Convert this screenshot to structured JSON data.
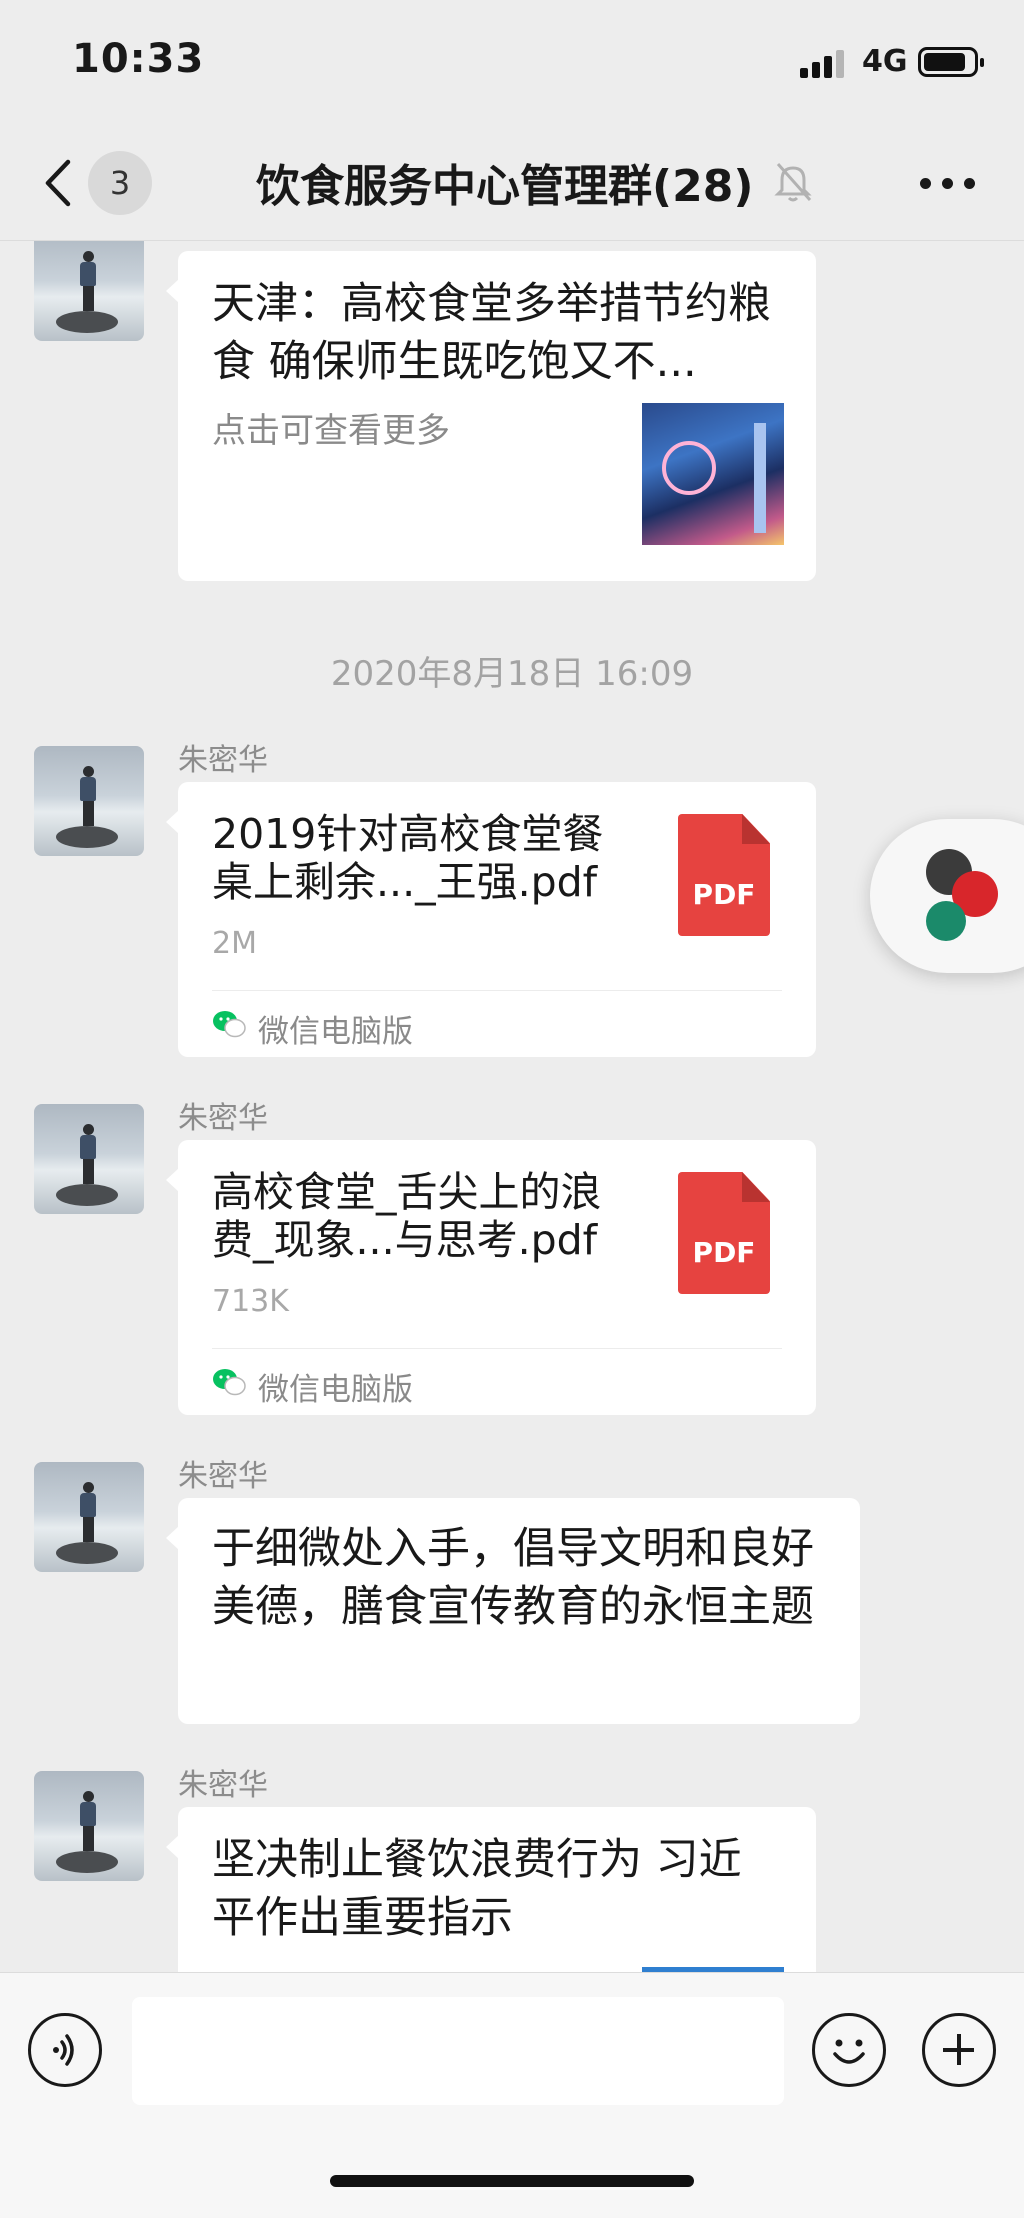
{
  "status_bar": {
    "time": "10:33",
    "network": "4G",
    "battery_level": 0.85
  },
  "nav": {
    "back_badge": "3",
    "title": "饮食服务中心管理群(28)"
  },
  "messages": [
    {
      "type": "link",
      "title": "天津：高校食堂多举措节约粮食 确保师生既吃饱又不...",
      "description": "点击可查看更多"
    },
    {
      "type": "time",
      "text": "2020年8月18日 16:09"
    },
    {
      "type": "file",
      "sender": "朱密华",
      "file_name": "2019针对高校食堂餐桌上剩余..._王强.pdf",
      "file_size": "2M",
      "file_type": "PDF",
      "source": "微信电脑版"
    },
    {
      "type": "file",
      "sender": "朱密华",
      "file_name": "高校食堂_舌尖上的浪费_现象...与思考.pdf",
      "file_size": "713K",
      "file_type": "PDF",
      "source": "微信电脑版"
    },
    {
      "type": "text",
      "sender": "朱密华",
      "text": "于细微处入手，倡导文明和良好美德，膳食宣传教育的永恒主题"
    },
    {
      "type": "link",
      "sender": "朱密华",
      "title": "坚决制止餐饮浪费行为 习近平作出重要指示"
    }
  ],
  "input": {
    "placeholder": ""
  },
  "icons": {
    "back": "chevron-left-icon",
    "mute": "bell-off-icon",
    "more": "more-dots-icon",
    "voice": "voice-icon",
    "emoji": "emoji-icon",
    "plus": "plus-icon"
  },
  "colors": {
    "pdf": "#e64340",
    "wechat_green": "#07c160",
    "background": "#ededed"
  }
}
